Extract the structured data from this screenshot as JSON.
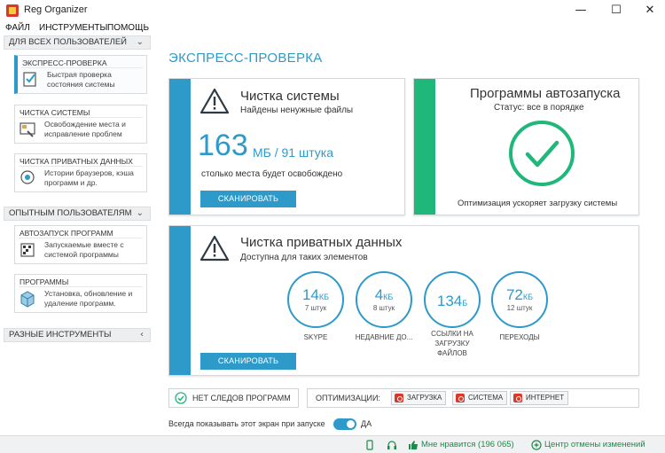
{
  "window": {
    "title": "Reg Organizer",
    "minimize_glyph": "—",
    "maximize_glyph": "☐",
    "close_glyph": "✕"
  },
  "menu": [
    "ФАЙЛ",
    "ИНСТРУМЕНТЫ",
    "ПОМОЩЬ"
  ],
  "sidebar": {
    "section_all_users": "ДЛЯ ВСЕХ ПОЛЬЗОВАТЕЛЕЙ",
    "section_experienced": "ОПЫТНЫМ ПОЛЬЗОВАТЕЛЯМ",
    "section_misc": "РАЗНЫЕ ИНСТРУМЕНТЫ",
    "items": [
      {
        "label": "ЭКСПРЕСС-ПРОВЕРКА",
        "desc": "Быстрая проверка состояния системы",
        "icon": "express-check-icon"
      },
      {
        "label": "ЧИСТКА СИСТЕМЫ",
        "desc": "Освобождение места и исправление проблем",
        "icon": "cleanup-icon"
      },
      {
        "label": "ЧИСТКА ПРИВАТНЫХ ДАННЫХ",
        "desc": "Истории браузеров, кэша программ и др.",
        "icon": "privacy-icon"
      },
      {
        "label": "АВТОЗАПУСК ПРОГРАММ",
        "desc": "Запускаемые вместе с системой программы",
        "icon": "autorun-icon"
      },
      {
        "label": "ПРОГРАММЫ",
        "desc": "Установка, обновление и удаление программ.",
        "icon": "programs-icon"
      }
    ]
  },
  "main": {
    "title": "ЭКСПРЕСС-ПРОВЕРКА",
    "system_cleanup": {
      "title": "Чистка системы",
      "subtitle": "Найдены ненужные файлы",
      "amount": "163",
      "amount_unit": "МБ / 91 штука",
      "note": "столько места будет освобождено",
      "button": "СКАНИРОВАТЬ"
    },
    "autorun": {
      "title": "Программы автозапуска",
      "status": "Статус: все в порядке",
      "note": "Оптимизация ускоряет загрузку системы"
    },
    "privacy": {
      "title": "Чистка приватных данных",
      "subtitle": "Доступна для таких элементов",
      "button": "СКАНИРОВАТЬ",
      "circles": [
        {
          "value": "14",
          "unit": "КБ",
          "count": "7 штук",
          "label": "SKYPE"
        },
        {
          "value": "4",
          "unit": "КБ",
          "count": "8 штук",
          "label": "НЕДАВНИЕ ДО..."
        },
        {
          "value": "134",
          "unit": "Б",
          "count": "",
          "label": "ССЫЛКИ НА ЗАГРУЗКУ ФАЙЛОВ"
        },
        {
          "value": "72",
          "unit": "КБ",
          "count": "12 штук",
          "label": "ПЕРЕХОДЫ"
        }
      ]
    },
    "no_traces": "НЕТ СЛЕДОВ ПРОГРАММ",
    "optimizations_label": "ОПТИМИЗАЦИИ:",
    "optimizations": [
      "ЗАГРУЗКА",
      "СИСТЕМА",
      "ИНТЕРНЕТ"
    ],
    "show_on_start": "Всегда показывать этот экран при запуске",
    "toggle_value": "ДА"
  },
  "statusbar": {
    "likes": "Мне нравится (196 065)",
    "undo_center": "Центр отмены изменений"
  },
  "colors": {
    "accent": "#2e9ac9",
    "success": "#1fb87a",
    "status_text": "#1d8a4a"
  }
}
